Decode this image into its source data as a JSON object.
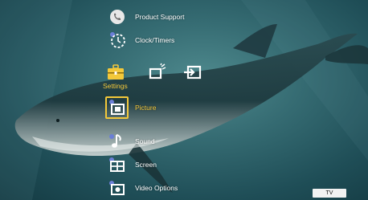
{
  "menu": {
    "items": [
      {
        "label": "Product Support",
        "icon": "phone-icon"
      },
      {
        "label": "Clock/Timers",
        "icon": "clock-icon"
      },
      {
        "label": "Picture",
        "icon": "picture-icon",
        "selected": true
      },
      {
        "label": "Sound",
        "icon": "music-note-icon"
      },
      {
        "label": "Screen",
        "icon": "screen-icon"
      },
      {
        "label": "Video Options",
        "icon": "video-options-icon"
      }
    ]
  },
  "categories": {
    "selected_label": "Settings",
    "items": [
      {
        "icon": "toolbox-icon"
      },
      {
        "icon": "external-inputs-icon"
      },
      {
        "icon": "input-switch-icon"
      }
    ]
  },
  "status": {
    "source": "TV"
  },
  "colors": {
    "accent": "#f3c83a",
    "background": "#2f6169"
  }
}
